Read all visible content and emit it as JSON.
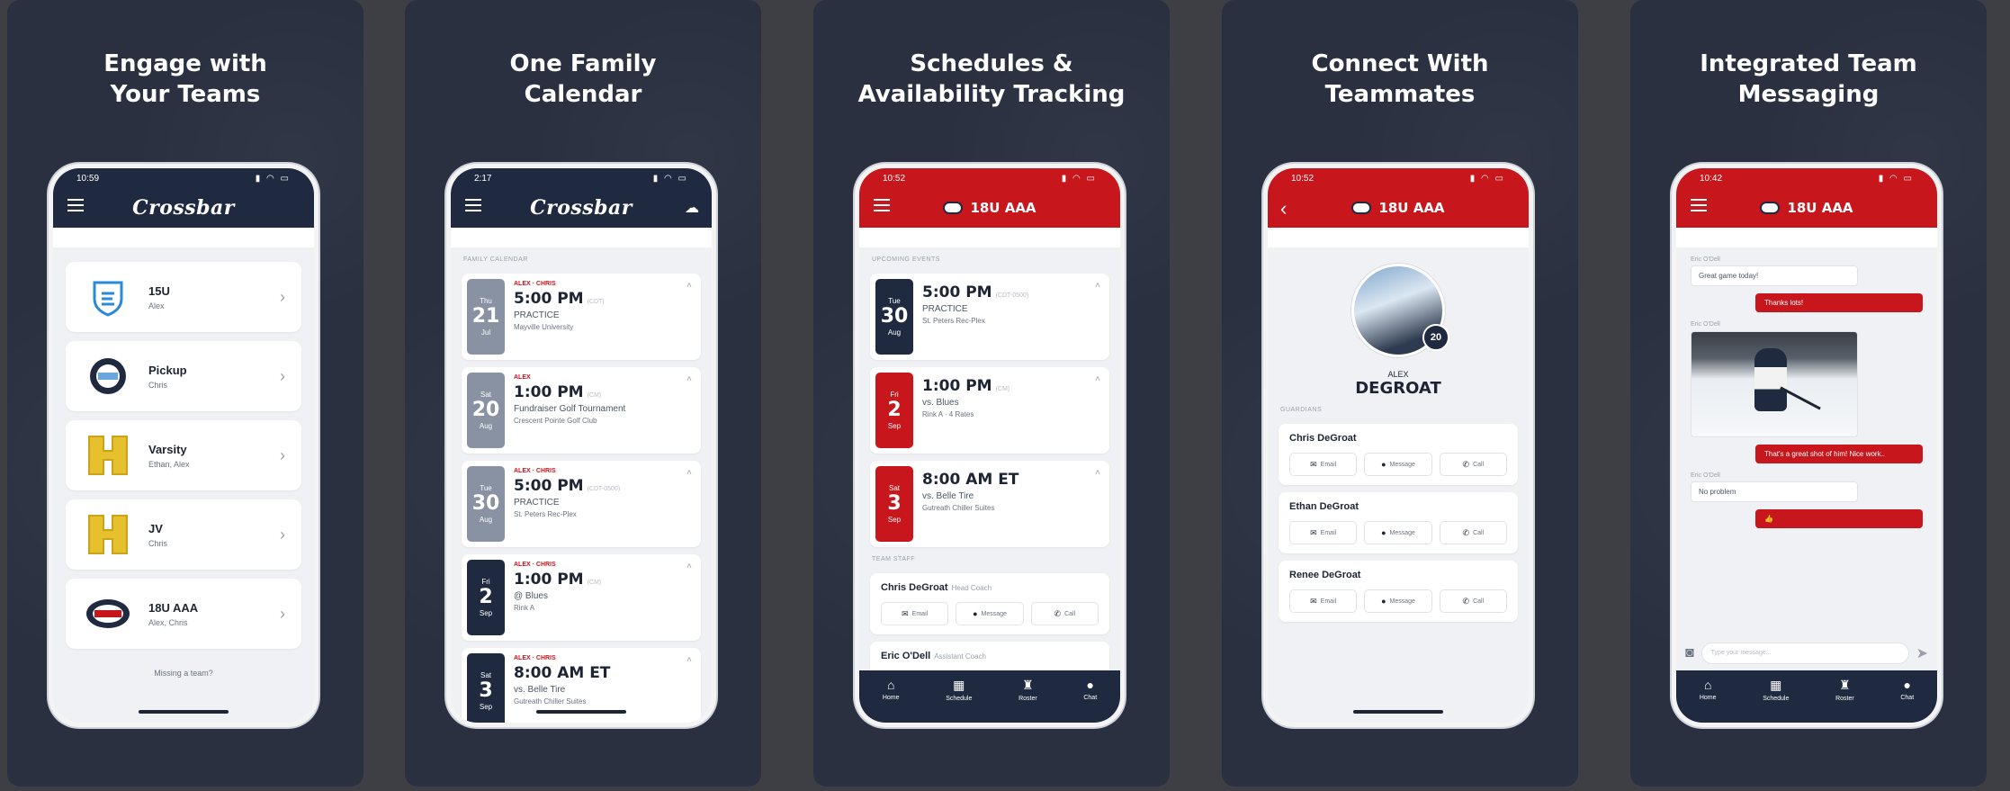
{
  "panels": [
    {
      "headline_l1": "Engage with",
      "headline_l2": "Your Teams",
      "status_time": "10:59",
      "app_logo": "Crossbar",
      "teams": [
        {
          "name": "15U",
          "sub": "Alex",
          "logo_icon": "shield-icon",
          "logo_color": "#2b8ad8"
        },
        {
          "name": "Pickup",
          "sub": "Chris",
          "logo_icon": "pickup-logo-icon",
          "logo_color": "#1f2940"
        },
        {
          "name": "Varsity",
          "sub": "Ethan, Alex",
          "logo_icon": "h-logo-icon",
          "logo_color": "#e7c02d"
        },
        {
          "name": "JV",
          "sub": "Chris",
          "logo_icon": "h-logo-icon",
          "logo_color": "#e7c02d"
        },
        {
          "name": "18U AAA",
          "sub": "Alex, Chris",
          "logo_icon": "puck-logo-icon",
          "logo_color": "#1f2940"
        }
      ],
      "missing": "Missing a team?"
    },
    {
      "headline_l1": "One Family",
      "headline_l2": "Calendar",
      "status_time": "2:17",
      "app_logo": "Crossbar",
      "section": "FAMILY CALENDAR",
      "events": [
        {
          "dow": "Thu",
          "day": "21",
          "mon": "Jul",
          "who": "ALEX · CHRIS",
          "time": "5:00 PM",
          "tz": "(CDT)",
          "title": "PRACTICE",
          "loc": "Mayville University",
          "color": "#8892a3"
        },
        {
          "dow": "Sat",
          "day": "20",
          "mon": "Aug",
          "who": "ALEX",
          "time": "1:00 PM",
          "tz": "(CM)",
          "title": "Fundraiser Golf Tournament",
          "loc": "Crescent Pointe Golf Club",
          "color": "#8892a3"
        },
        {
          "dow": "Tue",
          "day": "30",
          "mon": "Aug",
          "who": "ALEX · CHRIS",
          "time": "5:00 PM",
          "tz": "(CDT-0500)",
          "title": "PRACTICE",
          "loc": "St. Peters Rec-Plex",
          "color": "#8892a3"
        },
        {
          "dow": "Fri",
          "day": "2",
          "mon": "Sep",
          "who": "ALEX · CHRIS",
          "time": "1:00 PM",
          "tz": "(CM)",
          "title": "@ Blues",
          "loc": "Rink A",
          "color": "#1f2940"
        },
        {
          "dow": "Sat",
          "day": "3",
          "mon": "Sep",
          "who": "ALEX · CHRIS",
          "time": "8:00 AM ET",
          "tz": "",
          "title": "vs. Belle Tire",
          "loc": "Gutreath Chiller Suites",
          "color": "#1f2940"
        }
      ]
    },
    {
      "headline_l1": "Schedules &",
      "headline_l2": "Availability Tracking",
      "status_time": "10:52",
      "team_title": "18U AAA",
      "section_upcoming": "UPCOMING EVENTS",
      "events": [
        {
          "dow": "Tue",
          "day": "30",
          "mon": "Aug",
          "time": "5:00 PM",
          "tz": "(CDT-0500)",
          "title": "PRACTICE",
          "loc": "St. Peters Rec-Plex",
          "color": "#1f2940"
        },
        {
          "dow": "Fri",
          "day": "2",
          "mon": "Sep",
          "time": "1:00 PM",
          "tz": "(CM)",
          "title": "vs. Blues",
          "loc": "Rink A · 4 Rates",
          "color": "#c8161d"
        },
        {
          "dow": "Sat",
          "day": "3",
          "mon": "Sep",
          "time": "8:00 AM ET",
          "tz": "",
          "title": "vs. Belle Tire",
          "loc": "Gutreath Chiller Suites",
          "color": "#c8161d"
        }
      ],
      "section_staff": "TEAM STAFF",
      "staff": [
        {
          "name": "Chris DeGroat",
          "role": "Head Coach"
        },
        {
          "name": "Eric O'Dell",
          "role": "Assistant Coach"
        }
      ],
      "actions": [
        "Email",
        "Message",
        "Call"
      ],
      "tabs": [
        "Home",
        "Schedule",
        "Roster",
        "Chat"
      ]
    },
    {
      "headline_l1": "Connect With",
      "headline_l2": "Teammates",
      "status_time": "10:52",
      "team_title": "18U AAA",
      "badge": "20",
      "first_name": "ALEX",
      "last_name": "DEGROAT",
      "section": "GUARDIANS",
      "guardians": [
        "Chris DeGroat",
        "Ethan DeGroat",
        "Renee DeGroat"
      ],
      "actions": [
        "Email",
        "Message",
        "Call"
      ]
    },
    {
      "headline_l1": "Integrated Team",
      "headline_l2": "Messaging",
      "status_time": "10:42",
      "team_title": "18U AAA",
      "sender": "Eric O'Dell",
      "m1": "Great game today!",
      "m2": "Thanks lots!",
      "m3": "That's a great shot of him! Nice work..",
      "m4": "No problem",
      "m5": "👍",
      "placeholder": "Type your message...",
      "tabs": [
        "Home",
        "Schedule",
        "Roster",
        "Chat"
      ]
    }
  ]
}
